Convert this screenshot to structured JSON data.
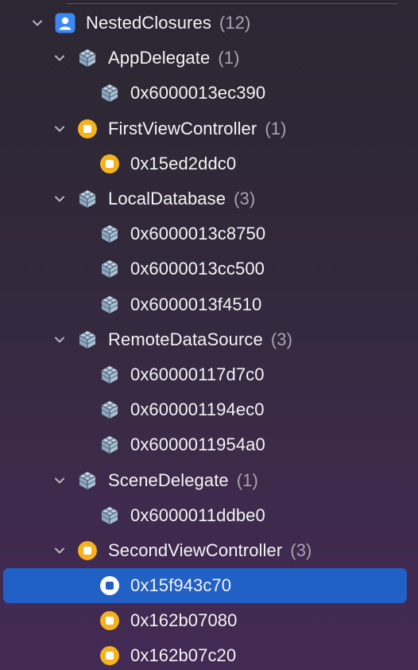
{
  "tree": {
    "root": {
      "label": "NestedClosures",
      "count": "(12)"
    },
    "groups": [
      {
        "label": "AppDelegate",
        "count": "(1)",
        "kind": "struct",
        "instances": [
          {
            "label": "0x6000013ec390"
          }
        ]
      },
      {
        "label": "FirstViewController",
        "count": "(1)",
        "kind": "class",
        "instances": [
          {
            "label": "0x15ed2ddc0"
          }
        ]
      },
      {
        "label": "LocalDatabase",
        "count": "(3)",
        "kind": "struct",
        "instances": [
          {
            "label": "0x6000013c8750"
          },
          {
            "label": "0x6000013cc500"
          },
          {
            "label": "0x6000013f4510"
          }
        ]
      },
      {
        "label": "RemoteDataSource",
        "count": "(3)",
        "kind": "struct",
        "instances": [
          {
            "label": "0x60000117d7c0"
          },
          {
            "label": "0x600001194ec0"
          },
          {
            "label": "0x6000011954a0"
          }
        ]
      },
      {
        "label": "SceneDelegate",
        "count": "(1)",
        "kind": "struct",
        "instances": [
          {
            "label": "0x6000011ddbe0"
          }
        ]
      },
      {
        "label": "SecondViewController",
        "count": "(3)",
        "kind": "class",
        "instances": [
          {
            "label": "0x15f943c70",
            "selected": true
          },
          {
            "label": "0x162b07080"
          },
          {
            "label": "0x162b07c20"
          }
        ]
      }
    ]
  },
  "icons": {
    "root": "person-icon",
    "struct": "cube-icon",
    "class": "object-icon",
    "disclosure": "chevron-down-icon"
  },
  "colors": {
    "selection": "#2160c4",
    "root_icon": "#3a87f5",
    "object_icon": "#f5b21c",
    "cube_icon": "#a9bfd4",
    "count_text": "#a8a3ad"
  }
}
